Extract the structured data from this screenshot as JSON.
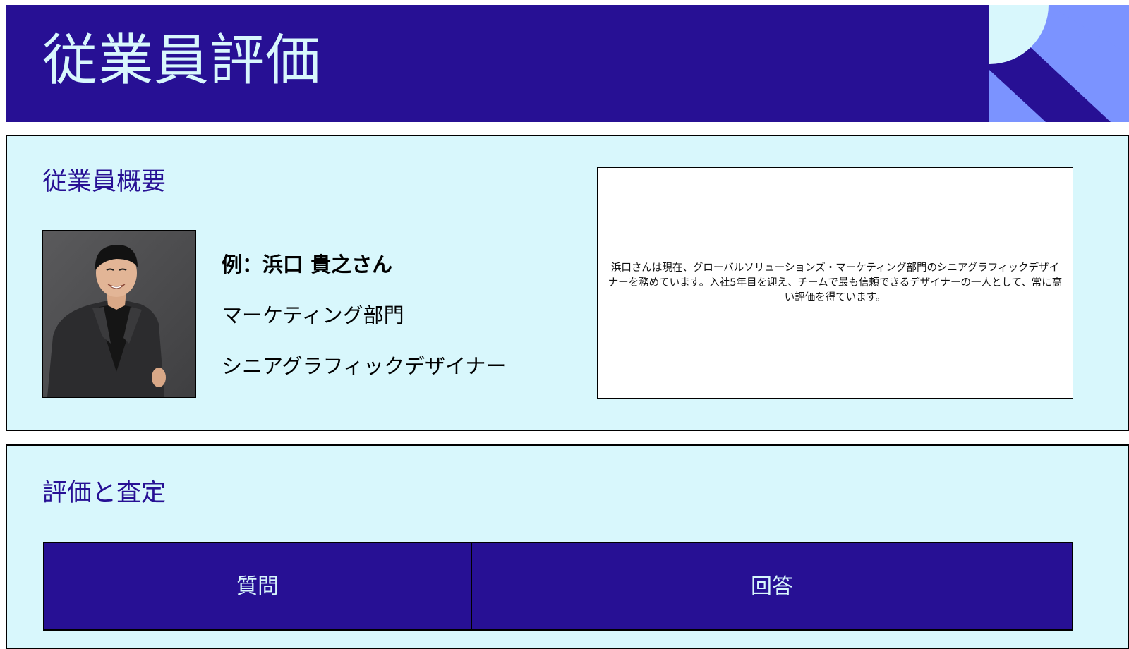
{
  "header": {
    "title": "従業員評価"
  },
  "summary": {
    "section_title": "従業員概要",
    "photo_alt": "浜口 貴之さんの写真",
    "name": "例：浜口 貴之さん",
    "department": "マーケティング部門",
    "job_title": "シニアグラフィックデザイナー",
    "description": "浜口さんは現在、グローバルソリューションズ・マーケティング部門のシニアグラフィックデザイナーを務めています。入社5年目を迎え、チームで最も信頼できるデザイナーの一人として、常に高い評価を得ています。"
  },
  "evaluation": {
    "section_title": "評価と査定",
    "columns": [
      "質問",
      "回答"
    ]
  },
  "colors": {
    "primary": "#271094",
    "panel_background": "#d8f7fc",
    "accent_light": "#d8f7fc",
    "accent_blue": "#7b93ff"
  }
}
